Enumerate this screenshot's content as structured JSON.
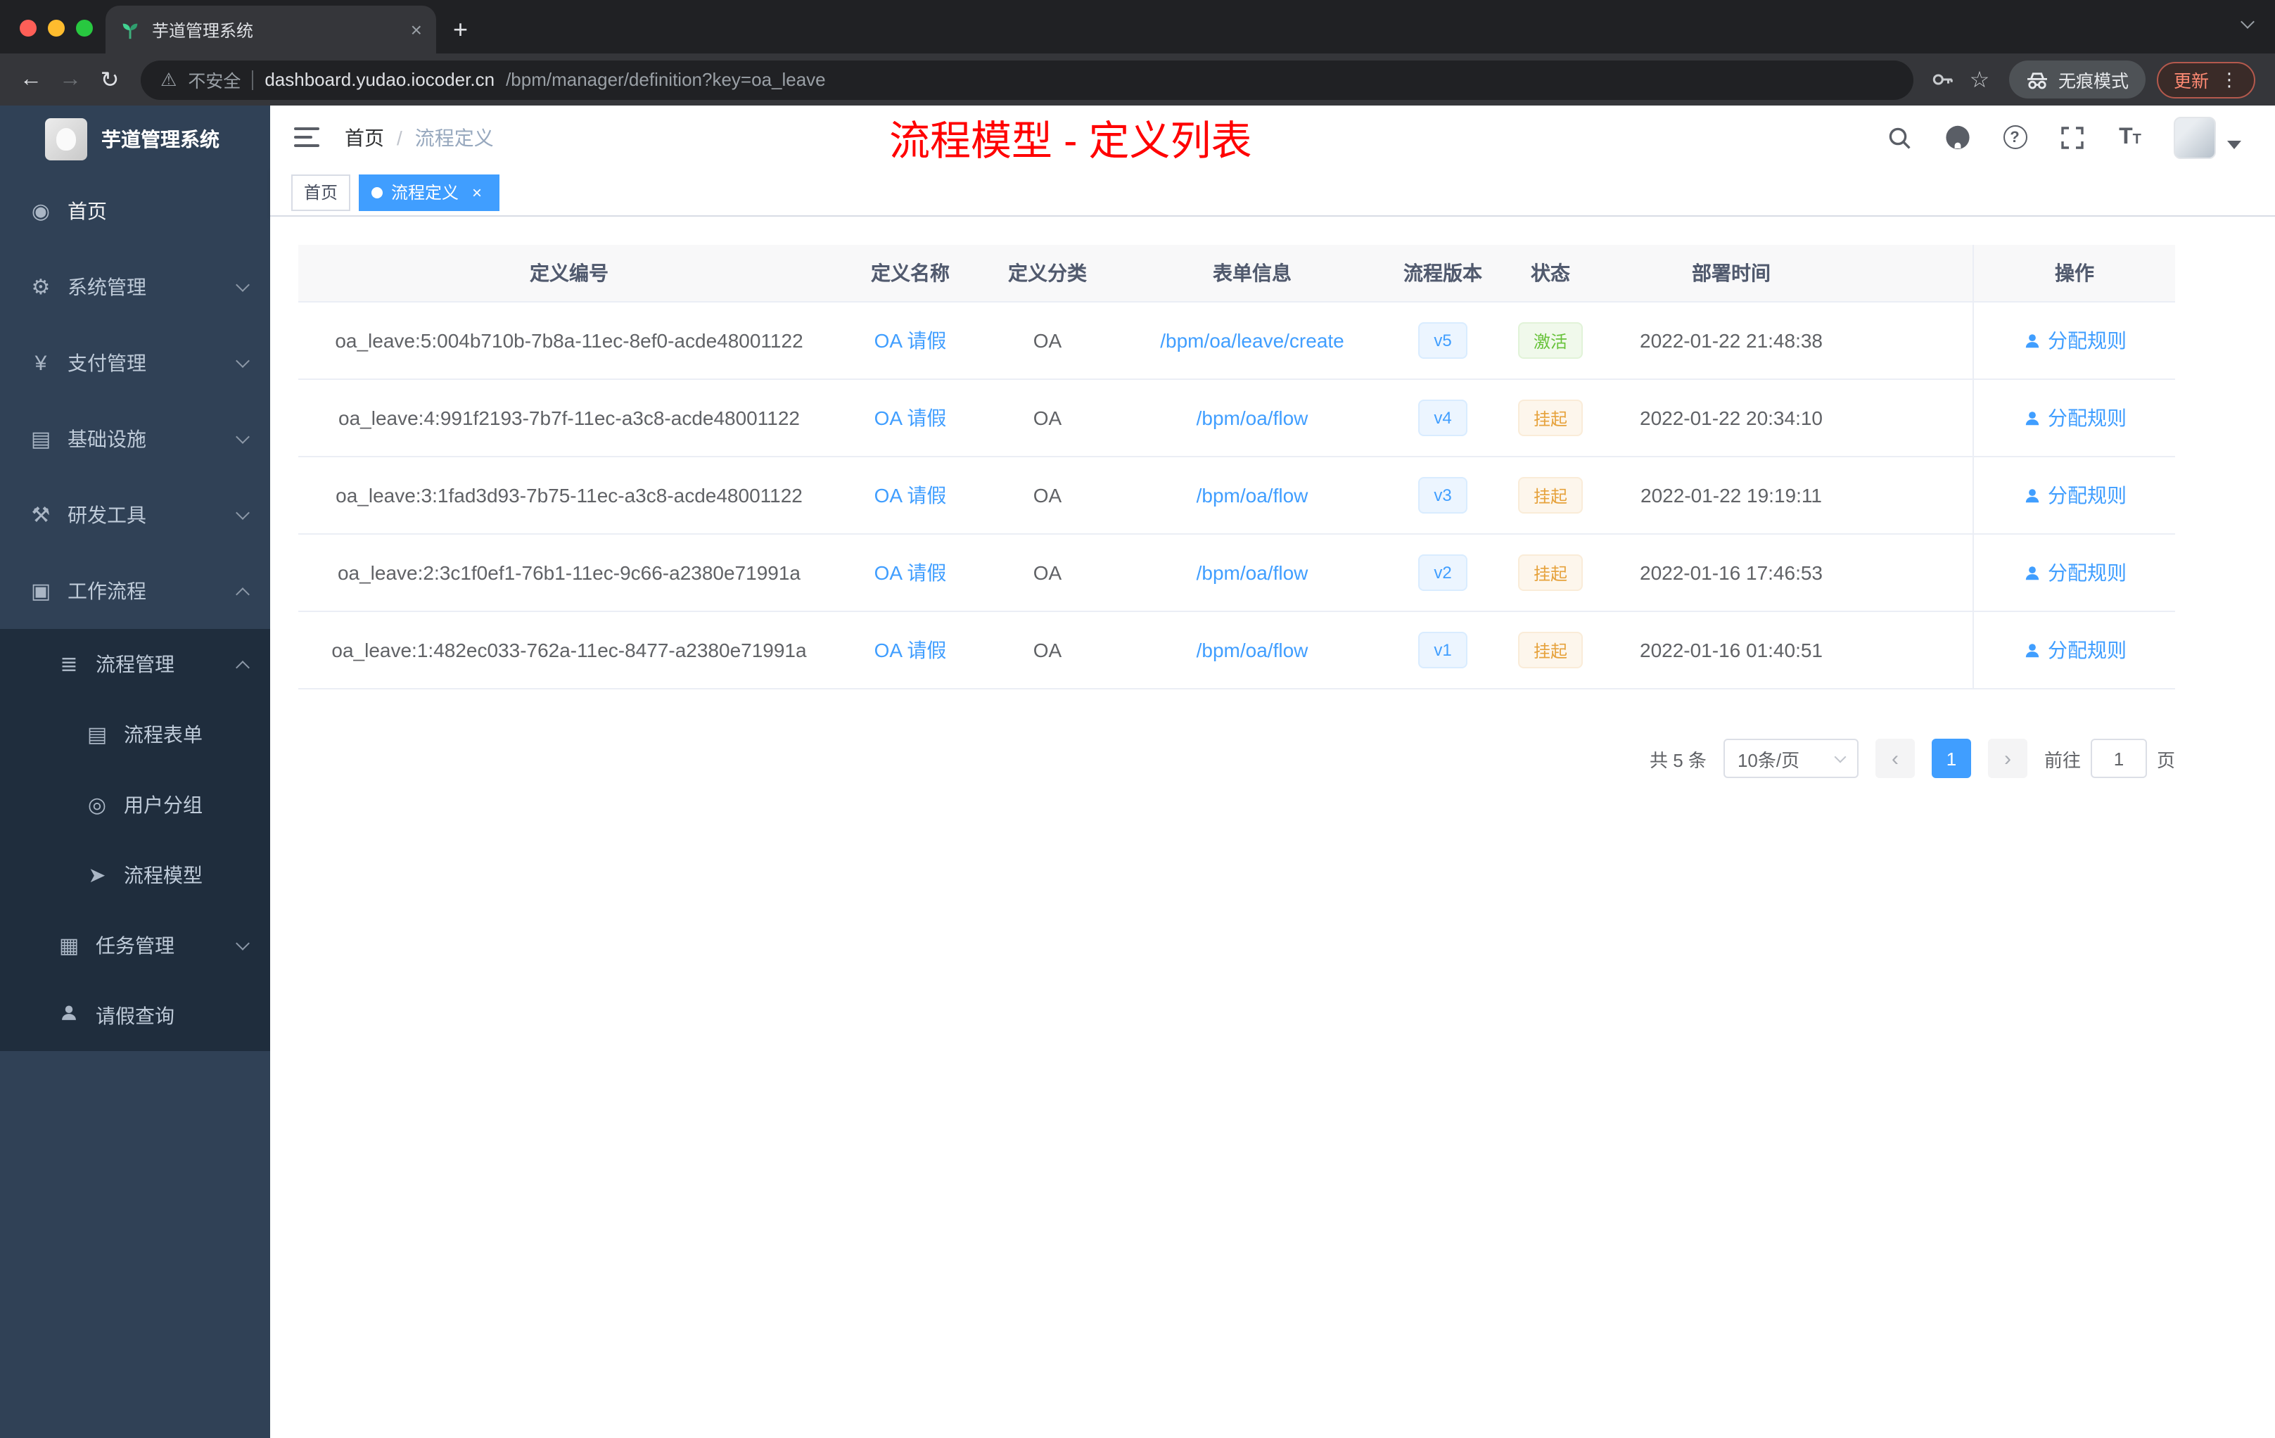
{
  "colors": {
    "accent": "#409eff",
    "annotation_red": "#ff0000",
    "sidebar_bg": "#304156",
    "submenu_bg": "#1f2d3d",
    "success": "#67c23a",
    "warning": "#e6a23c"
  },
  "browser": {
    "tab_title": "芋道管理系统",
    "security_label": "不安全",
    "url_domain": "dashboard.yudao.iocoder.cn",
    "url_path": "/bpm/manager/definition?key=oa_leave",
    "incognito_label": "无痕模式",
    "update_label": "更新"
  },
  "sidebar": {
    "logo_title": "芋道管理系统",
    "items": [
      {
        "label": "首页",
        "icon": "dashboard-icon",
        "level": 1,
        "active": true
      },
      {
        "label": "系统管理",
        "icon": "gear-icon",
        "level": 1,
        "expand": "down"
      },
      {
        "label": "支付管理",
        "icon": "yen-icon",
        "level": 1,
        "expand": "down"
      },
      {
        "label": "基础设施",
        "icon": "server-icon",
        "level": 1,
        "expand": "down"
      },
      {
        "label": "研发工具",
        "icon": "tools-icon",
        "level": 1,
        "expand": "down"
      },
      {
        "label": "工作流程",
        "icon": "workflow-icon",
        "level": 1,
        "expand": "up"
      },
      {
        "label": "流程管理",
        "icon": "list-icon",
        "level": 2,
        "expand": "up"
      },
      {
        "label": "流程表单",
        "icon": "document-icon",
        "level": 3
      },
      {
        "label": "用户分组",
        "icon": "users-icon",
        "level": 3
      },
      {
        "label": "流程模型",
        "icon": "send-icon",
        "level": 3
      },
      {
        "label": "任务管理",
        "icon": "tasks-icon",
        "level": 2,
        "expand": "down"
      },
      {
        "label": "请假查询",
        "icon": "person-icon",
        "level": 2
      }
    ]
  },
  "header": {
    "breadcrumb": [
      "首页",
      "流程定义"
    ],
    "breadcrumb_separator": "/",
    "annotation": "流程模型 - 定义列表"
  },
  "tags": [
    {
      "label": "首页",
      "active": false,
      "closable": false
    },
    {
      "label": "流程定义",
      "active": true,
      "closable": true
    }
  ],
  "table": {
    "columns": [
      "定义编号",
      "定义名称",
      "定义分类",
      "表单信息",
      "流程版本",
      "状态",
      "部署时间",
      "操作"
    ],
    "rows": [
      {
        "id": "oa_leave:5:004b710b-7b8a-11ec-8ef0-acde48001122",
        "name": "OA 请假",
        "category": "OA",
        "form": "/bpm/oa/leave/create",
        "version": "v5",
        "status": "激活",
        "status_type": "success",
        "time": "2022-01-22 21:48:38",
        "action": "分配规则"
      },
      {
        "id": "oa_leave:4:991f2193-7b7f-11ec-a3c8-acde48001122",
        "name": "OA 请假",
        "category": "OA",
        "form": "/bpm/oa/flow",
        "version": "v4",
        "status": "挂起",
        "status_type": "warning",
        "time": "2022-01-22 20:34:10",
        "action": "分配规则"
      },
      {
        "id": "oa_leave:3:1fad3d93-7b75-11ec-a3c8-acde48001122",
        "name": "OA 请假",
        "category": "OA",
        "form": "/bpm/oa/flow",
        "version": "v3",
        "status": "挂起",
        "status_type": "warning",
        "time": "2022-01-22 19:19:11",
        "action": "分配规则"
      },
      {
        "id": "oa_leave:2:3c1f0ef1-76b1-11ec-9c66-a2380e71991a",
        "name": "OA 请假",
        "category": "OA",
        "form": "/bpm/oa/flow",
        "version": "v2",
        "status": "挂起",
        "status_type": "warning",
        "time": "2022-01-16 17:46:53",
        "action": "分配规则"
      },
      {
        "id": "oa_leave:1:482ec033-762a-11ec-8477-a2380e71991a",
        "name": "OA 请假",
        "category": "OA",
        "form": "/bpm/oa/flow",
        "version": "v1",
        "status": "挂起",
        "status_type": "warning",
        "time": "2022-01-16 01:40:51",
        "action": "分配规则"
      }
    ]
  },
  "pagination": {
    "total": "共 5 条",
    "page_size": "10条/页",
    "current": "1",
    "goto_label": "前往",
    "goto_page": "1",
    "page_unit": "页"
  }
}
